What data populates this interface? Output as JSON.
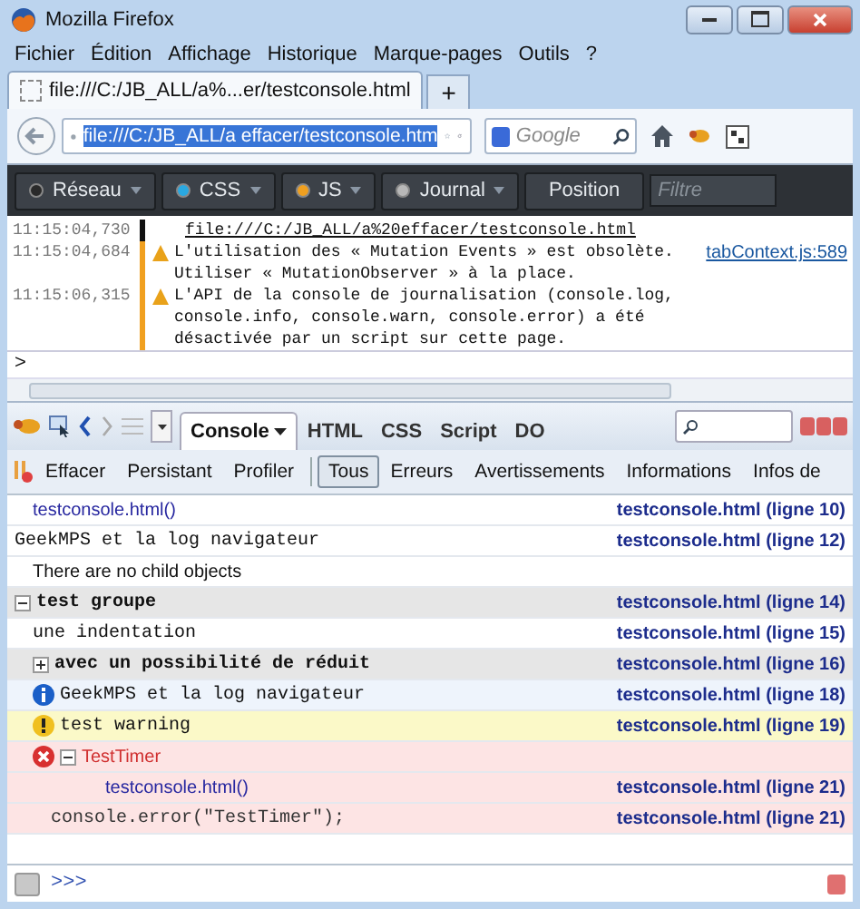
{
  "window": {
    "title": "Mozilla Firefox"
  },
  "menu": [
    "Fichier",
    "Édition",
    "Affichage",
    "Historique",
    "Marque-pages",
    "Outils",
    "?"
  ],
  "tabs": [
    {
      "title": "file:///C:/JB_ALL/a%...er/testconsole.html",
      "selected": true
    }
  ],
  "new_tab": "+",
  "url": {
    "value": "file:///C:/JB_ALL/a effacer/testconsole.htm"
  },
  "search": {
    "placeholder": "Google"
  },
  "devtools": {
    "filters": [
      {
        "label": "Réseau",
        "color": "#2a2a2a"
      },
      {
        "label": "CSS",
        "color": "#2aa8e0"
      },
      {
        "label": "JS",
        "color": "#f0a020"
      },
      {
        "label": "Journal",
        "color": "#b8b8b8"
      }
    ],
    "position": "Position",
    "filter_placeholder": "Filtre"
  },
  "web_console": [
    {
      "time": "11:15:04,730",
      "kind": "page",
      "text": "file:///C:/JB_ALL/a%20effacer/testconsole.html"
    },
    {
      "time": "11:15:04,684",
      "kind": "warning",
      "text": "L'utilisation des « Mutation Events » est obsolète. Utiliser « MutationObserver » à la place.",
      "source": "tabContext.js:589"
    },
    {
      "time": "11:15:06,315",
      "kind": "warning",
      "text": "L'API de la console de journalisation (console.log, console.info, console.warn, console.error) a été désactivée par un script sur cette page."
    }
  ],
  "input_prompt": ">",
  "firebug": {
    "tabs": [
      {
        "label": "Console",
        "selected": true
      },
      {
        "label": "HTML",
        "selected": false
      },
      {
        "label": "CSS",
        "selected": false
      },
      {
        "label": "Script",
        "selected": false
      },
      {
        "label": "DO",
        "selected": false
      }
    ],
    "actions": [
      "Effacer",
      "Persistant",
      "Profiler"
    ],
    "filters": [
      {
        "label": "Tous",
        "selected": true
      },
      {
        "label": "Erreurs",
        "selected": false
      },
      {
        "label": "Avertissements",
        "selected": false
      },
      {
        "label": "Informations",
        "selected": false
      },
      {
        "label": "Infos de",
        "selected": false
      }
    ],
    "rows": [
      {
        "kind": "trace",
        "text": "testconsole.html()",
        "source": "testconsole.html (ligne 10)"
      },
      {
        "kind": "log",
        "text": "GeekMPS et la log navigateur",
        "source": "testconsole.html (ligne 12)"
      },
      {
        "kind": "note",
        "text": "There are no child objects"
      },
      {
        "kind": "group",
        "text": "test groupe",
        "source": "testconsole.html (ligne 14)",
        "expanded": true,
        "children": [
          {
            "kind": "log",
            "text": "une indentation",
            "source": "testconsole.html (ligne 15)"
          },
          {
            "kind": "group",
            "text": "avec un possibilité de réduit",
            "source": "testconsole.html (ligne 16)",
            "expanded": false
          },
          {
            "kind": "info",
            "text": "GeekMPS et la log navigateur",
            "source": "testconsole.html (ligne 18)"
          },
          {
            "kind": "warning",
            "text": "test warning",
            "source": "testconsole.html (ligne 19)"
          },
          {
            "kind": "error",
            "text": "TestTimer",
            "expanded": true,
            "children": [
              {
                "kind": "trace",
                "text": "testconsole.html()",
                "source": "testconsole.html (ligne 21)"
              },
              {
                "kind": "code",
                "text": "console.error(\"TestTimer\");",
                "source": "testconsole.html (ligne 21)"
              }
            ]
          }
        ]
      }
    ]
  },
  "command_prompt": ">>>"
}
